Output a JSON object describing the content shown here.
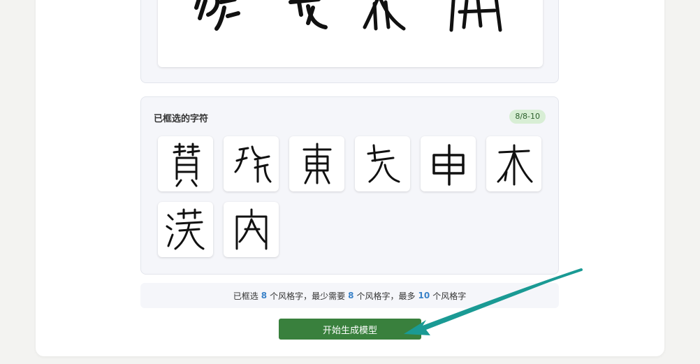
{
  "selected_panel": {
    "title": "已框选的字符",
    "count_badge": "8/8-10"
  },
  "info_bar": {
    "part1": "已框选",
    "selected": "8",
    "part2": "个风格字，最少需要",
    "minimum": "8",
    "part3": "个风格字，最多",
    "maximum": "10",
    "part4": "个风格字"
  },
  "generate_button": {
    "label": "开始生成模型"
  },
  "colors": {
    "button": "#39803d",
    "badge_bg": "#d8eed5",
    "number_accent": "#3a82c8",
    "arrow": "#1a9a94"
  }
}
